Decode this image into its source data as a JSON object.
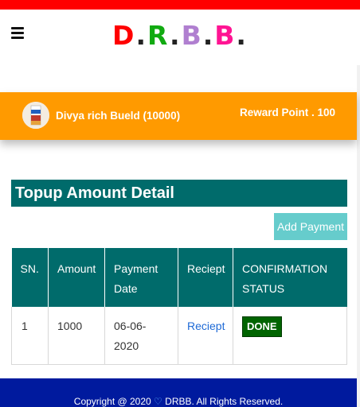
{
  "header": {
    "menu_icon": "hamburger-menu-icon",
    "logo": {
      "letters": [
        "D",
        "R",
        "B",
        "B"
      ],
      "dot": "."
    }
  },
  "user_bar": {
    "avatar_icon": "product-avatar-icon",
    "name": "Divya rich Bueld (10000)",
    "reward": "Reward Point . 100"
  },
  "section": {
    "title": "Topup Amount Detail",
    "add_button": "Add Payment"
  },
  "table": {
    "headers": [
      "SN.",
      "Amount",
      "Payment Date",
      "Reciept",
      "CONFIRMATION STATUS"
    ],
    "rows": [
      {
        "sn": "1",
        "amount": "1000",
        "date": "06-06-2020",
        "receipt": "Reciept",
        "status": "DONE"
      }
    ]
  },
  "footer": {
    "prefix": "Copyright @ 2020 ",
    "heart_icon": "heart-icon",
    "suffix": " DRBB. All Rights Reserved."
  },
  "colors": {
    "top_bar": "#ff0000",
    "orange_bar": "#ff9a00",
    "teal": "#006b6b",
    "add_button": "#66cccc",
    "status_done": "#006400",
    "footer": "#001a9e"
  }
}
